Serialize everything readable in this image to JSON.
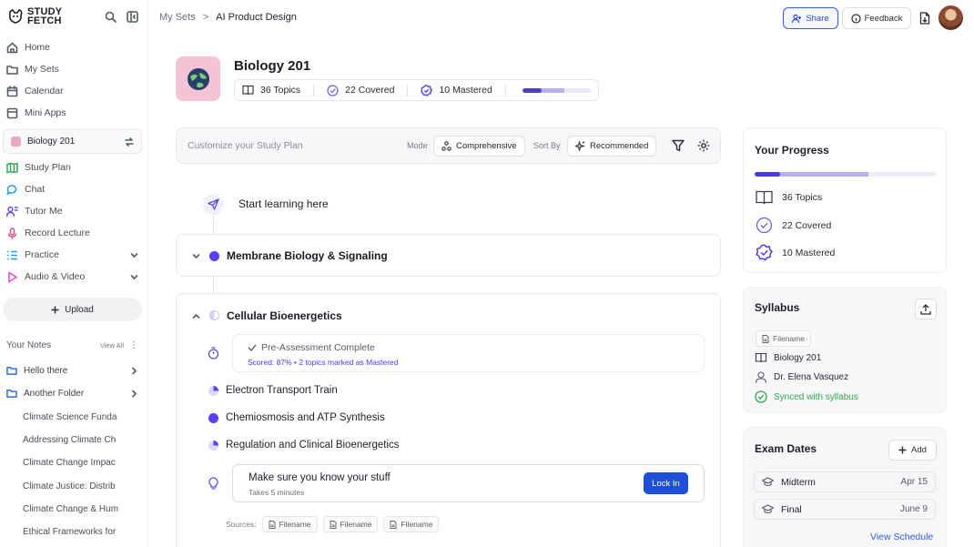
{
  "brand": {
    "line1": "STUDY",
    "line2": "FETCH"
  },
  "sidebar": {
    "nav": [
      {
        "label": "Home",
        "icon": "home-icon"
      },
      {
        "label": "My Sets",
        "icon": "folder-icon"
      },
      {
        "label": "Calendar",
        "icon": "calendar-icon"
      },
      {
        "label": "Mini Apps",
        "icon": "apps-icon"
      }
    ],
    "current_set": "Biology 201",
    "tools": [
      {
        "label": "Study Plan",
        "icon": "map-icon",
        "color": "#3aa65a"
      },
      {
        "label": "Chat",
        "icon": "chat-icon",
        "color": "#2f9be0"
      },
      {
        "label": "Tutor Me",
        "icon": "tutor-icon",
        "color": "#6b4fe0"
      },
      {
        "label": "Record Lecture",
        "icon": "mic-icon",
        "color": "#e04f8f"
      },
      {
        "label": "Practice",
        "icon": "list-icon",
        "color": "#2f9be0"
      },
      {
        "label": "Audio & Video",
        "icon": "play-icon",
        "color": "#d94fd0"
      }
    ],
    "upload_label": "Upload",
    "notes_title": "Your Notes",
    "view_all": "View All",
    "folders": [
      "Hello there",
      "Another Folder"
    ],
    "notes": [
      "Climate Science Funda",
      "Addressing Climate Ch",
      "Climate Change Impac",
      "Climate Justice: Distrib",
      "Climate Change & Hum",
      "Ethical Frameworks for"
    ]
  },
  "topbar": {
    "crumb_parent": "My Sets",
    "crumb_sep": ">",
    "crumb_current": "AI Product Design",
    "share_label": "Share",
    "feedback_label": "Feedback"
  },
  "header": {
    "title": "Biology 201",
    "topics": "36 Topics",
    "covered": "22 Covered",
    "mastered": "10 Mastered",
    "progress_mastered": 0.28,
    "progress_covered": 0.61
  },
  "toolbar": {
    "placeholder": "Customize your Study Plan",
    "mode_label": "Mode",
    "mode_value": "Comprehensive",
    "sort_label": "Sort By",
    "sort_value": "Recommended"
  },
  "plan": {
    "start": "Start learning here",
    "topic1": "Membrane Biology & Signaling",
    "topic2": "Cellular Bioenergetics",
    "pre_title": "Pre-Assessment Complete",
    "pre_detail": "Scored: 87%  •  2 topics marked as Mastered",
    "subtopics": [
      "Electron Transport Train",
      "Chemiosmosis and ATP Synthesis",
      "Regulation and Clinical Bioenergetics"
    ],
    "check_title": "Make sure you know your stuff",
    "check_time": "Takes 5 minutes",
    "lockin_label": "Lock In",
    "sources_label": "Sources:",
    "sources": [
      "Filename",
      "Filename",
      "Filename"
    ]
  },
  "progress_panel": {
    "title": "Your Progress",
    "topics": "36 Topics",
    "covered": "22 Covered",
    "mastered": "10 Mastered",
    "progress_mastered": 0.14,
    "progress_covered": 0.63
  },
  "syllabus": {
    "title": "Syllabus",
    "file_chip": "Filename",
    "course": "Biology 201",
    "instructor": "Dr. Elena Vasquez",
    "status": "Synced with syllabus"
  },
  "exams": {
    "title": "Exam Dates",
    "add_label": "Add",
    "items": [
      {
        "name": "Midterm",
        "date": "Apr 15"
      },
      {
        "name": "Final",
        "date": "June 9"
      }
    ],
    "view_schedule": "View Schedule"
  }
}
